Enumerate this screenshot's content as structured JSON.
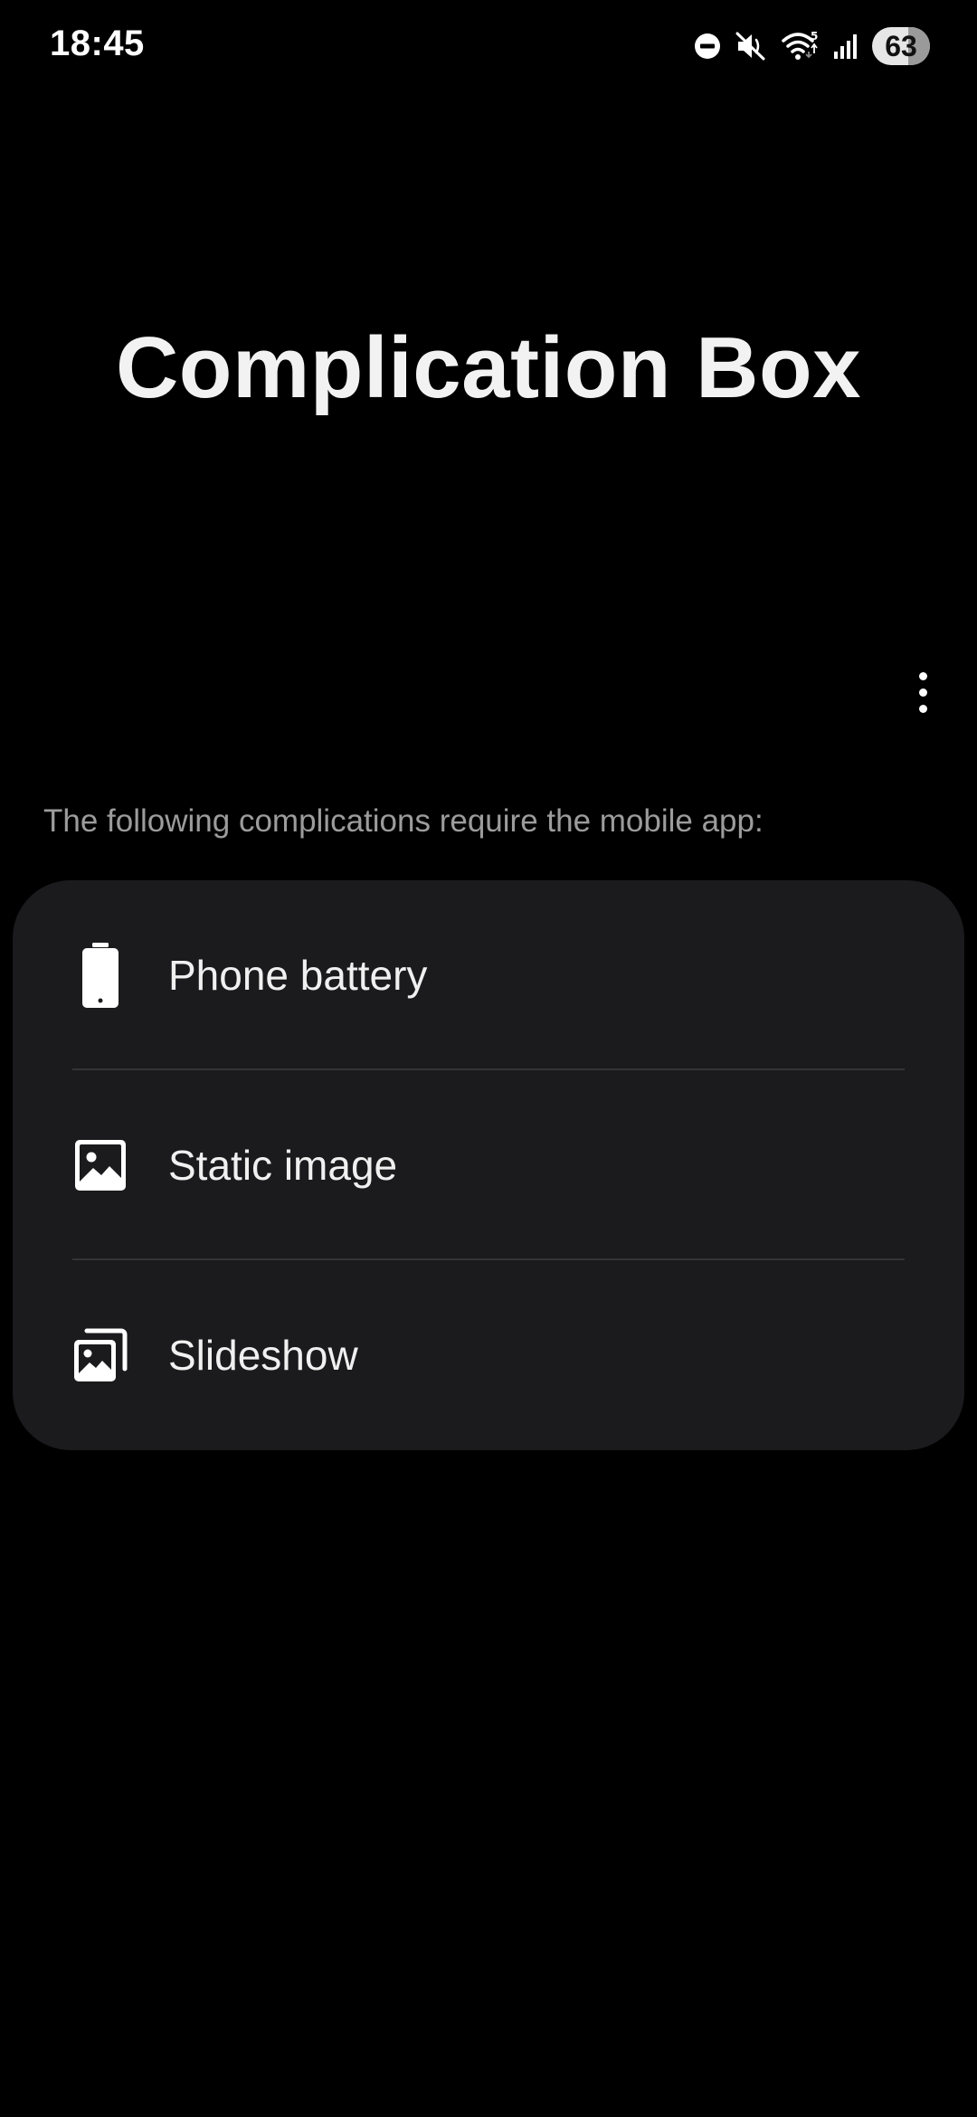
{
  "status_bar": {
    "time": "18:45",
    "battery_level": "63",
    "battery_fraction": 0.63,
    "icons": [
      "do-not-disturb-icon",
      "mute-icon",
      "wifi-icon",
      "signal-icon",
      "battery-icon"
    ]
  },
  "page": {
    "title": "Complication Box",
    "more_options_icon": "more-vertical-icon"
  },
  "section": {
    "description": "The following complications require the mobile app:"
  },
  "complications": [
    {
      "label": "Phone battery",
      "icon": "phone-battery-icon"
    },
    {
      "label": "Static image",
      "icon": "image-icon"
    },
    {
      "label": "Slideshow",
      "icon": "slideshow-icon"
    }
  ],
  "colors": {
    "background": "#000000",
    "card": "#1b1b1d",
    "primary_text": "#f0f0f0",
    "secondary_text": "#9c9c9c",
    "divider": "#343436"
  }
}
